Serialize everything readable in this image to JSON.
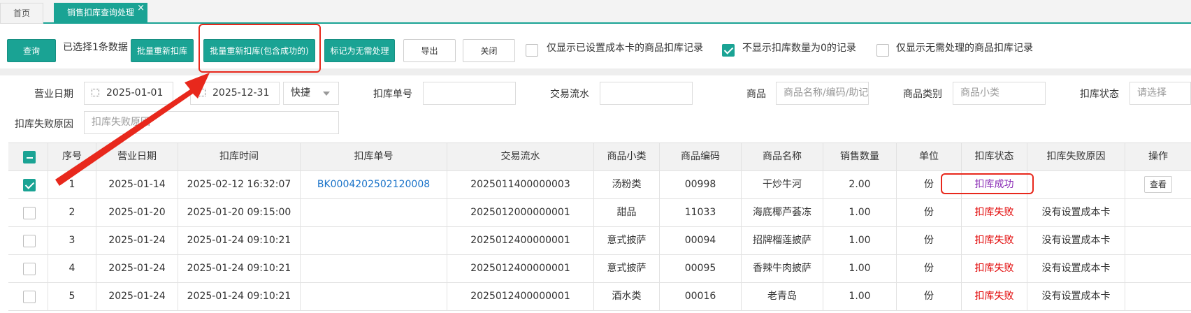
{
  "tabs": [
    {
      "label": "首页"
    },
    {
      "label": "销售扣库查询处理",
      "close": "×"
    }
  ],
  "toolbar": {
    "query": "查询",
    "selected_info": "已选择1条数据",
    "batch_rededuct": "批量重新扣库",
    "batch_rededuct_incl": "批量重新扣库(包含成功的)",
    "mark_no_process": "标记为无需处理",
    "export": "导出",
    "close": "关闭",
    "opt_cost_card": "仅显示已设置成本卡的商品扣库记录",
    "opt_hide_zero": "不显示扣库数量为0的记录",
    "opt_no_process": "仅显示无需处理的商品扣库记录"
  },
  "filters": {
    "biz_date_label": "营业日期",
    "date_from": "2025-01-01",
    "date_to": "2025-12-31",
    "quick": "快捷",
    "deduct_no_label": "扣库单号",
    "deduct_no_value": "",
    "trade_no_label": "交易流水",
    "trade_no_value": "",
    "goods_label": "商品",
    "goods_placeholder": "商品名称/编码/助记",
    "category_label": "商品类别",
    "category_placeholder": "商品小类",
    "status_label": "扣库状态",
    "status_placeholder": "请选择",
    "fail_reason_label": "扣库失败原因",
    "fail_reason_placeholder": "扣库失败原因"
  },
  "table": {
    "headers": [
      "序号",
      "营业日期",
      "扣库时间",
      "扣库单号",
      "交易流水",
      "商品小类",
      "商品编码",
      "商品名称",
      "销售数量",
      "单位",
      "扣库状态",
      "扣库失败原因",
      "操作"
    ],
    "rows": [
      {
        "seq": "1",
        "date": "2025-01-14",
        "time": "2025-02-12 16:32:07",
        "deduct_no": "BK0004202502120008",
        "trade_no": "2025011400000003",
        "category": "汤粉类",
        "code": "00998",
        "name": "干炒牛河",
        "qty": "2.00",
        "unit": "份",
        "status": "扣库成功",
        "reason": "",
        "action": "查看",
        "checked": true
      },
      {
        "seq": "2",
        "date": "2025-01-20",
        "time": "2025-01-20 09:15:00",
        "deduct_no": "",
        "trade_no": "2025012000000001",
        "category": "甜品",
        "code": "11033",
        "name": "海底椰芦荟冻",
        "qty": "1.00",
        "unit": "份",
        "status": "扣库失败",
        "reason": "没有设置成本卡",
        "action": "",
        "checked": false
      },
      {
        "seq": "3",
        "date": "2025-01-24",
        "time": "2025-01-24 09:10:21",
        "deduct_no": "",
        "trade_no": "2025012400000001",
        "category": "意式披萨",
        "code": "00094",
        "name": "招牌榴莲披萨",
        "qty": "1.00",
        "unit": "份",
        "status": "扣库失败",
        "reason": "没有设置成本卡",
        "action": "",
        "checked": false
      },
      {
        "seq": "4",
        "date": "2025-01-24",
        "time": "2025-01-24 09:10:21",
        "deduct_no": "",
        "trade_no": "2025012400000001",
        "category": "意式披萨",
        "code": "00095",
        "name": "香辣牛肉披萨",
        "qty": "1.00",
        "unit": "份",
        "status": "扣库失败",
        "reason": "没有设置成本卡",
        "action": "",
        "checked": false
      },
      {
        "seq": "5",
        "date": "2025-01-24",
        "time": "2025-01-24 09:10:21",
        "deduct_no": "",
        "trade_no": "2025012400000001",
        "category": "酒水类",
        "code": "00016",
        "name": "老青岛",
        "qty": "1.00",
        "unit": "份",
        "status": "扣库失败",
        "reason": "没有设置成本卡",
        "action": "",
        "checked": false
      }
    ]
  },
  "colors": {
    "accent": "#1aa394",
    "success": "#8a2bb5",
    "fail": "#e10000",
    "link": "#1a73c9",
    "annotation": "#e8281c"
  }
}
